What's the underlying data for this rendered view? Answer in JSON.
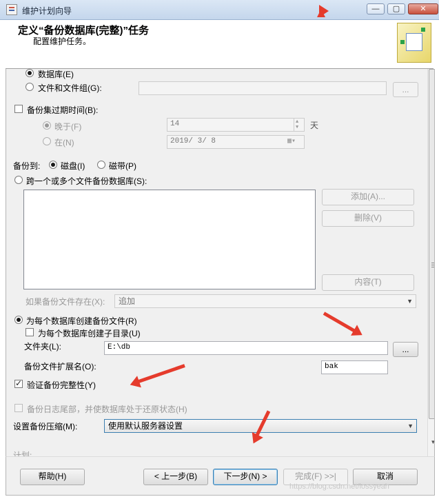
{
  "window": {
    "title": "维护计划向导"
  },
  "header": {
    "title": "定义“备份数据库(完整)”任务",
    "subtitle": "配置维护任务。"
  },
  "source": {
    "database_label": "数据库(E)",
    "files_label": "文件和文件组(G):",
    "files_value": "",
    "browse_label": "..."
  },
  "expiry": {
    "checkbox_label": "备份集过期时间(B):",
    "after_label": "晚于(F)",
    "after_value": "14",
    "unit": "天",
    "on_label": "在(N)",
    "on_value": "2019/ 3/ 8"
  },
  "backup_to": {
    "label": "备份到:",
    "disk_label": "磁盘(I)",
    "tape_label": "磁带(P)"
  },
  "span": {
    "label": "跨一个或多个文件备份数据库(S):",
    "add_label": "添加(A)...",
    "remove_label": "删除(V)",
    "contents_label": "内容(T)",
    "if_exists_label": "如果备份文件存在(X):",
    "if_exists_value": "追加"
  },
  "per_db": {
    "label": "为每个数据库创建备份文件(R)",
    "subdir_label": "为每个数据库创建子目录(U)",
    "folder_label": "文件夹(L):",
    "folder_value": "E:\\db",
    "folder_browse": "...",
    "ext_label": "备份文件扩展名(O):",
    "ext_value": "bak"
  },
  "verify": {
    "label": "验证备份完整性(Y)",
    "checked": true
  },
  "tail": {
    "label": "备份日志尾部，并使数据库处于还原状态(H)"
  },
  "compression": {
    "label": "设置备份压缩(M):",
    "value": "使用默认服务器设置"
  },
  "schedule": {
    "label": "计划:"
  },
  "footer": {
    "help": "帮助(H)",
    "back": "< 上一步(B)",
    "next": "下一步(N) >",
    "finish": "完成(F) >>|",
    "cancel": "取消"
  },
  "watermark": "https://blog.csdn.net/lossyeah",
  "colors": {
    "annotation_arrow": "#e53b2c",
    "focus_border": "#3c7fb1"
  }
}
